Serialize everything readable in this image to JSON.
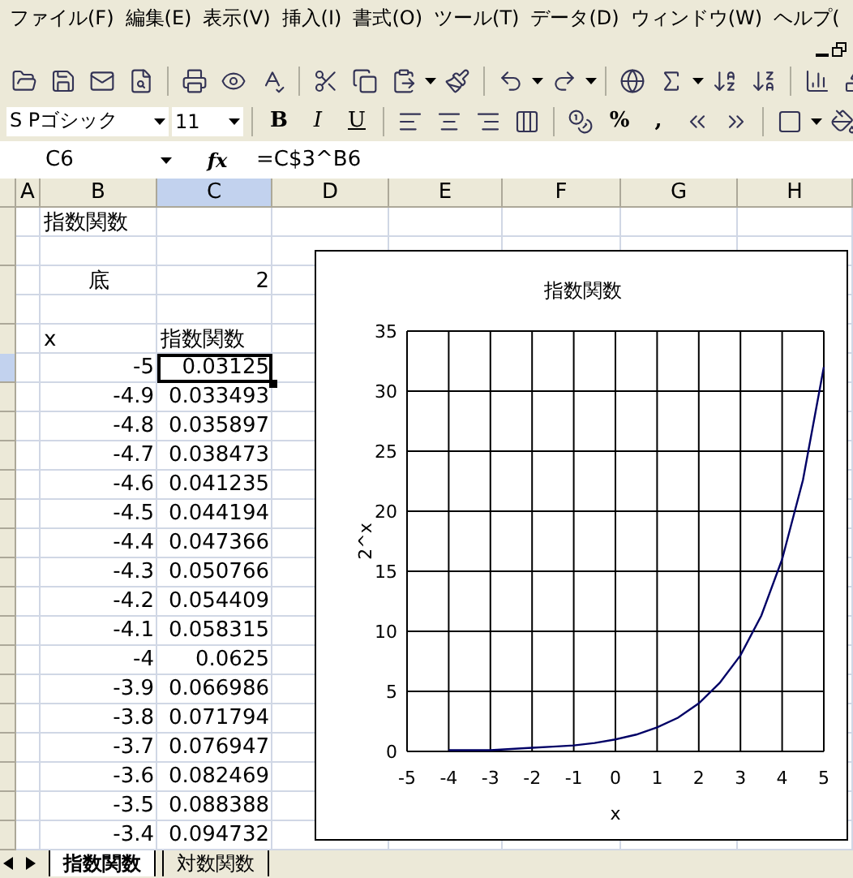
{
  "menu": [
    "ファイル(F)",
    "編集(E)",
    "表示(V)",
    "挿入(I)",
    "書式(O)",
    "ツール(T)",
    "データ(D)",
    "ウィンドウ(W)",
    "ヘルプ("
  ],
  "format_bar": {
    "font": "S Pゴシック",
    "size": "11",
    "bold": "B",
    "italic": "I",
    "underline": "U",
    "percent": "%",
    "comma": ","
  },
  "formula_bar": {
    "name_box": "C6",
    "fx": "fx",
    "formula": "=C$3^B6"
  },
  "columns": [
    {
      "label": "A",
      "selected": false
    },
    {
      "label": "B",
      "selected": false
    },
    {
      "label": "C",
      "selected": true
    },
    {
      "label": "D",
      "selected": false
    },
    {
      "label": "E",
      "selected": false
    },
    {
      "label": "F",
      "selected": false
    },
    {
      "label": "G",
      "selected": false
    },
    {
      "label": "H",
      "selected": false
    }
  ],
  "rows": [
    {
      "selected": false,
      "b": {
        "text": "指数関数",
        "kind": "text"
      }
    },
    {
      "selected": false
    },
    {
      "selected": false,
      "b": {
        "text": "底",
        "kind": "label"
      },
      "c": {
        "text": "2",
        "kind": "number"
      }
    },
    {
      "selected": false
    },
    {
      "selected": false,
      "b": {
        "text": "x",
        "kind": "text"
      },
      "c": {
        "text": "指数関数",
        "kind": "text"
      }
    },
    {
      "selected": true,
      "b": {
        "text": "-5",
        "kind": "number"
      },
      "c": {
        "text": "0.03125",
        "kind": "number"
      }
    },
    {
      "selected": false,
      "b": {
        "text": "-4.9",
        "kind": "number"
      },
      "c": {
        "text": "0.033493",
        "kind": "number"
      }
    },
    {
      "selected": false,
      "b": {
        "text": "-4.8",
        "kind": "number"
      },
      "c": {
        "text": "0.035897",
        "kind": "number"
      }
    },
    {
      "selected": false,
      "b": {
        "text": "-4.7",
        "kind": "number"
      },
      "c": {
        "text": "0.038473",
        "kind": "number"
      }
    },
    {
      "selected": false,
      "b": {
        "text": "-4.6",
        "kind": "number"
      },
      "c": {
        "text": "0.041235",
        "kind": "number"
      }
    },
    {
      "selected": false,
      "b": {
        "text": "-4.5",
        "kind": "number"
      },
      "c": {
        "text": "0.044194",
        "kind": "number"
      }
    },
    {
      "selected": false,
      "b": {
        "text": "-4.4",
        "kind": "number"
      },
      "c": {
        "text": "0.047366",
        "kind": "number"
      }
    },
    {
      "selected": false,
      "b": {
        "text": "-4.3",
        "kind": "number"
      },
      "c": {
        "text": "0.050766",
        "kind": "number"
      }
    },
    {
      "selected": false,
      "b": {
        "text": "-4.2",
        "kind": "number"
      },
      "c": {
        "text": "0.054409",
        "kind": "number"
      }
    },
    {
      "selected": false,
      "b": {
        "text": "-4.1",
        "kind": "number"
      },
      "c": {
        "text": "0.058315",
        "kind": "number"
      }
    },
    {
      "selected": false,
      "b": {
        "text": "-4",
        "kind": "number"
      },
      "c": {
        "text": "0.0625",
        "kind": "number"
      }
    },
    {
      "selected": false,
      "b": {
        "text": "-3.9",
        "kind": "number"
      },
      "c": {
        "text": "0.066986",
        "kind": "number"
      }
    },
    {
      "selected": false,
      "b": {
        "text": "-3.8",
        "kind": "number"
      },
      "c": {
        "text": "0.071794",
        "kind": "number"
      }
    },
    {
      "selected": false,
      "b": {
        "text": "-3.7",
        "kind": "number"
      },
      "c": {
        "text": "0.076947",
        "kind": "number"
      }
    },
    {
      "selected": false,
      "b": {
        "text": "-3.6",
        "kind": "number"
      },
      "c": {
        "text": "0.082469",
        "kind": "number"
      }
    },
    {
      "selected": false,
      "b": {
        "text": "-3.5",
        "kind": "number"
      },
      "c": {
        "text": "0.088388",
        "kind": "number"
      }
    },
    {
      "selected": false,
      "b": {
        "text": "-3.4",
        "kind": "number"
      },
      "c": {
        "text": "0.094732",
        "kind": "number"
      }
    }
  ],
  "chart": {
    "chart_data": {
      "type": "line",
      "title": "指数関数",
      "xlabel": "x",
      "ylabel": "2^x",
      "grid": true,
      "x": [
        -4,
        -3.5,
        -3,
        -2.5,
        -2,
        -1.5,
        -1,
        -0.5,
        0,
        0.5,
        1,
        1.5,
        2,
        2.5,
        3,
        3.5,
        4,
        4.5,
        5
      ],
      "series": [
        {
          "color": "#000066",
          "values": [
            0.1,
            0.1,
            0.1,
            0.2,
            0.3,
            0.4,
            0.5,
            0.7,
            1,
            1.4,
            2,
            2.8,
            4,
            5.7,
            8,
            11.3,
            16,
            22.6,
            32
          ]
        }
      ],
      "xlim": [
        -5,
        5
      ],
      "ylim": [
        0,
        35
      ],
      "xticks": [
        -5,
        -4,
        -3,
        -2,
        -1,
        0,
        1,
        2,
        3,
        4,
        5
      ],
      "yticks": [
        0,
        5,
        10,
        15,
        20,
        25,
        30,
        35
      ]
    }
  },
  "sheet_tabs": [
    {
      "label": "指数関数",
      "selected": true
    },
    {
      "label": "対数関数",
      "selected": false
    }
  ]
}
